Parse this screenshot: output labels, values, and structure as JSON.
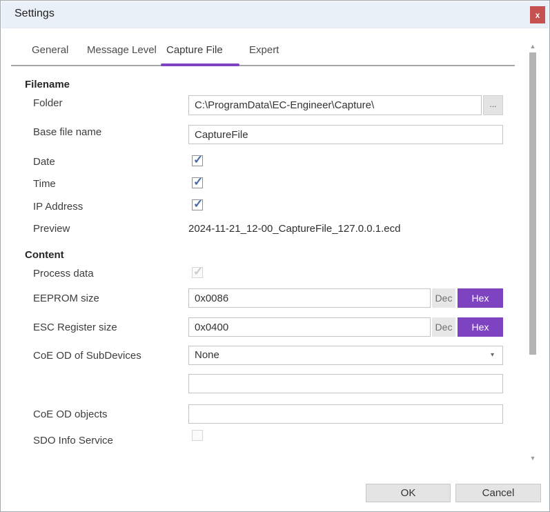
{
  "colors": {
    "accent_purple": "#7d43c1",
    "close_red": "#c75050",
    "titlebar_bg": "#e9f0f7",
    "check_blue": "#4a69a5"
  },
  "window": {
    "title": "Settings",
    "close_icon": "x"
  },
  "tabs": {
    "items": [
      {
        "label": "General"
      },
      {
        "label": "Message Level"
      },
      {
        "label": "Capture File"
      },
      {
        "label": "Expert"
      }
    ],
    "active": "Capture File"
  },
  "form": {
    "filename_header": "Filename",
    "folder": {
      "label": "Folder",
      "value": "C:\\ProgramData\\EC-Engineer\\Capture\\",
      "browse_label": "..."
    },
    "base_file_name": {
      "label": "Base file name",
      "value": "CaptureFile"
    },
    "date": {
      "label": "Date",
      "checked": true
    },
    "time": {
      "label": "Time",
      "checked": true
    },
    "ip_address": {
      "label": "IP Address",
      "checked": true
    },
    "preview": {
      "label": "Preview",
      "value": "2024-11-21_12-00_CaptureFile_127.0.0.1.ecd"
    },
    "content_header": "Content",
    "process_data": {
      "label": "Process data",
      "checked": true,
      "enabled": false
    },
    "eeprom_size": {
      "label": "EEPROM size",
      "value": "0x0086",
      "dec_label": "Dec",
      "hex_label": "Hex",
      "mode": "Hex"
    },
    "esc_register_size": {
      "label": "ESC Register size",
      "value": "0x0400",
      "dec_label": "Dec",
      "hex_label": "Hex",
      "mode": "Hex"
    },
    "coe_od_subdevices": {
      "label": "CoE OD of SubDevices",
      "value": "None",
      "arrow_icon": "▾"
    },
    "coe_od_extra": {
      "value": ""
    },
    "coe_od_objects": {
      "label": "CoE OD objects",
      "value": ""
    },
    "sdo_info_service": {
      "label": "SDO Info Service",
      "checked": false,
      "enabled": false
    }
  },
  "footer": {
    "ok_label": "OK",
    "cancel_label": "Cancel"
  },
  "scrollbar": {
    "up_icon": "▲",
    "down_icon": "▼"
  }
}
